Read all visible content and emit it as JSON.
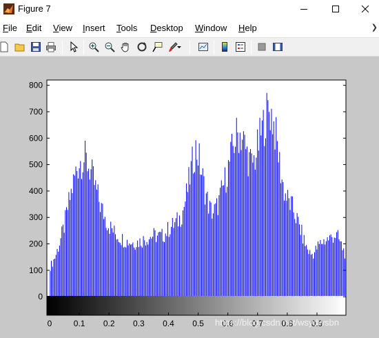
{
  "window": {
    "title": "Figure 7",
    "minimize_icon": "minimize-icon",
    "maximize_icon": "maximize-icon",
    "close_icon": "close-icon"
  },
  "menu": {
    "items": [
      {
        "label": "File",
        "ul": "F",
        "rest": "ile"
      },
      {
        "label": "Edit",
        "ul": "E",
        "rest": "dit"
      },
      {
        "label": "View",
        "ul": "V",
        "rest": "iew"
      },
      {
        "label": "Insert",
        "ul": "I",
        "rest": "nsert"
      },
      {
        "label": "Tools",
        "ul": "T",
        "rest": "ools"
      },
      {
        "label": "Desktop",
        "ul": "D",
        "rest": "esktop"
      },
      {
        "label": "Window",
        "ul": "W",
        "rest": "indow"
      },
      {
        "label": "Help",
        "ul": "H",
        "rest": "elp"
      }
    ],
    "overflow_icon": "chevron-right-icon"
  },
  "toolbar": {
    "buttons": [
      "new-figure-icon",
      "open-file-icon",
      "save-icon",
      "print-icon",
      "edit-plot-arrow-icon",
      "zoom-in-icon",
      "zoom-out-icon",
      "pan-hand-icon",
      "rotate-3d-icon",
      "data-cursor-icon",
      "brush-icon",
      "link-plot-icon",
      "colorbar-icon",
      "legend-icon",
      "hide-plot-tools-icon",
      "show-plot-tools-icon"
    ]
  },
  "watermark": "https://blog.csdn.net/wsydwsbn",
  "colors": {
    "bars": "#0000ff",
    "figure_bg": "#c8c8c8",
    "axes_bg": "#ffffff"
  },
  "chart_data": {
    "type": "bar",
    "title": "",
    "xlabel": "",
    "ylabel": "",
    "xlim": [
      0,
      1
    ],
    "ylim": [
      -70,
      820
    ],
    "yticks": [
      0,
      100,
      200,
      300,
      400,
      500,
      600,
      700,
      800
    ],
    "xticks": [
      "0",
      "0.1",
      "0.2",
      "0.3",
      "0.4",
      "0.5",
      "0.6",
      "0.7",
      "0.8",
      "0.9"
    ],
    "xtick_values": [
      0,
      0.1,
      0.2,
      0.3,
      0.4,
      0.5,
      0.6,
      0.7,
      0.8,
      0.9
    ],
    "grid": false,
    "colorbar": "grayscale gradient below axis (0 = black, 1 = white)",
    "series": [
      {
        "x_start": 0.002,
        "x_step": 0.00392,
        "x_end": 1.0,
        "control_points": [
          [
            0.0,
            110
          ],
          [
            0.01,
            130
          ],
          [
            0.02,
            155
          ],
          [
            0.03,
            190
          ],
          [
            0.04,
            230
          ],
          [
            0.05,
            270
          ],
          [
            0.06,
            330
          ],
          [
            0.07,
            380
          ],
          [
            0.08,
            430
          ],
          [
            0.09,
            480
          ],
          [
            0.1,
            510
          ],
          [
            0.11,
            520
          ],
          [
            0.12,
            520
          ],
          [
            0.13,
            500
          ],
          [
            0.14,
            470
          ],
          [
            0.15,
            430
          ],
          [
            0.16,
            390
          ],
          [
            0.17,
            350
          ],
          [
            0.18,
            320
          ],
          [
            0.19,
            290
          ],
          [
            0.2,
            270
          ],
          [
            0.21,
            255
          ],
          [
            0.22,
            240
          ],
          [
            0.23,
            230
          ],
          [
            0.24,
            222
          ],
          [
            0.25,
            215
          ],
          [
            0.26,
            210
          ],
          [
            0.27,
            208
          ],
          [
            0.28,
            205
          ],
          [
            0.29,
            205
          ],
          [
            0.3,
            208
          ],
          [
            0.31,
            212
          ],
          [
            0.32,
            218
          ],
          [
            0.33,
            222
          ],
          [
            0.34,
            228
          ],
          [
            0.35,
            232
          ],
          [
            0.36,
            230
          ],
          [
            0.37,
            228
          ],
          [
            0.38,
            230
          ],
          [
            0.39,
            240
          ],
          [
            0.4,
            255
          ],
          [
            0.41,
            265
          ],
          [
            0.42,
            275
          ],
          [
            0.43,
            285
          ],
          [
            0.44,
            300
          ],
          [
            0.45,
            330
          ],
          [
            0.46,
            380
          ],
          [
            0.47,
            440
          ],
          [
            0.48,
            500
          ],
          [
            0.49,
            560
          ],
          [
            0.5,
            540
          ],
          [
            0.51,
            480
          ],
          [
            0.52,
            420
          ],
          [
            0.53,
            370
          ],
          [
            0.54,
            330
          ],
          [
            0.55,
            320
          ],
          [
            0.56,
            330
          ],
          [
            0.57,
            360
          ],
          [
            0.58,
            400
          ],
          [
            0.59,
            440
          ],
          [
            0.6,
            480
          ],
          [
            0.61,
            530
          ],
          [
            0.62,
            580
          ],
          [
            0.63,
            610
          ],
          [
            0.64,
            620
          ],
          [
            0.65,
            600
          ],
          [
            0.66,
            560
          ],
          [
            0.67,
            520
          ],
          [
            0.68,
            500
          ],
          [
            0.69,
            520
          ],
          [
            0.7,
            560
          ],
          [
            0.71,
            610
          ],
          [
            0.72,
            650
          ],
          [
            0.73,
            690
          ],
          [
            0.74,
            710
          ],
          [
            0.75,
            680
          ],
          [
            0.76,
            620
          ],
          [
            0.77,
            540
          ],
          [
            0.78,
            460
          ],
          [
            0.79,
            400
          ],
          [
            0.8,
            370
          ],
          [
            0.81,
            350
          ],
          [
            0.82,
            330
          ],
          [
            0.83,
            300
          ],
          [
            0.84,
            270
          ],
          [
            0.85,
            235
          ],
          [
            0.86,
            200
          ],
          [
            0.87,
            175
          ],
          [
            0.88,
            160
          ],
          [
            0.89,
            165
          ],
          [
            0.9,
            185
          ],
          [
            0.91,
            200
          ],
          [
            0.92,
            210
          ],
          [
            0.93,
            215
          ],
          [
            0.94,
            220
          ],
          [
            0.95,
            225
          ],
          [
            0.96,
            235
          ],
          [
            0.97,
            225
          ],
          [
            0.98,
            200
          ],
          [
            0.99,
            175
          ],
          [
            1.0,
            150
          ]
        ]
      }
    ]
  }
}
